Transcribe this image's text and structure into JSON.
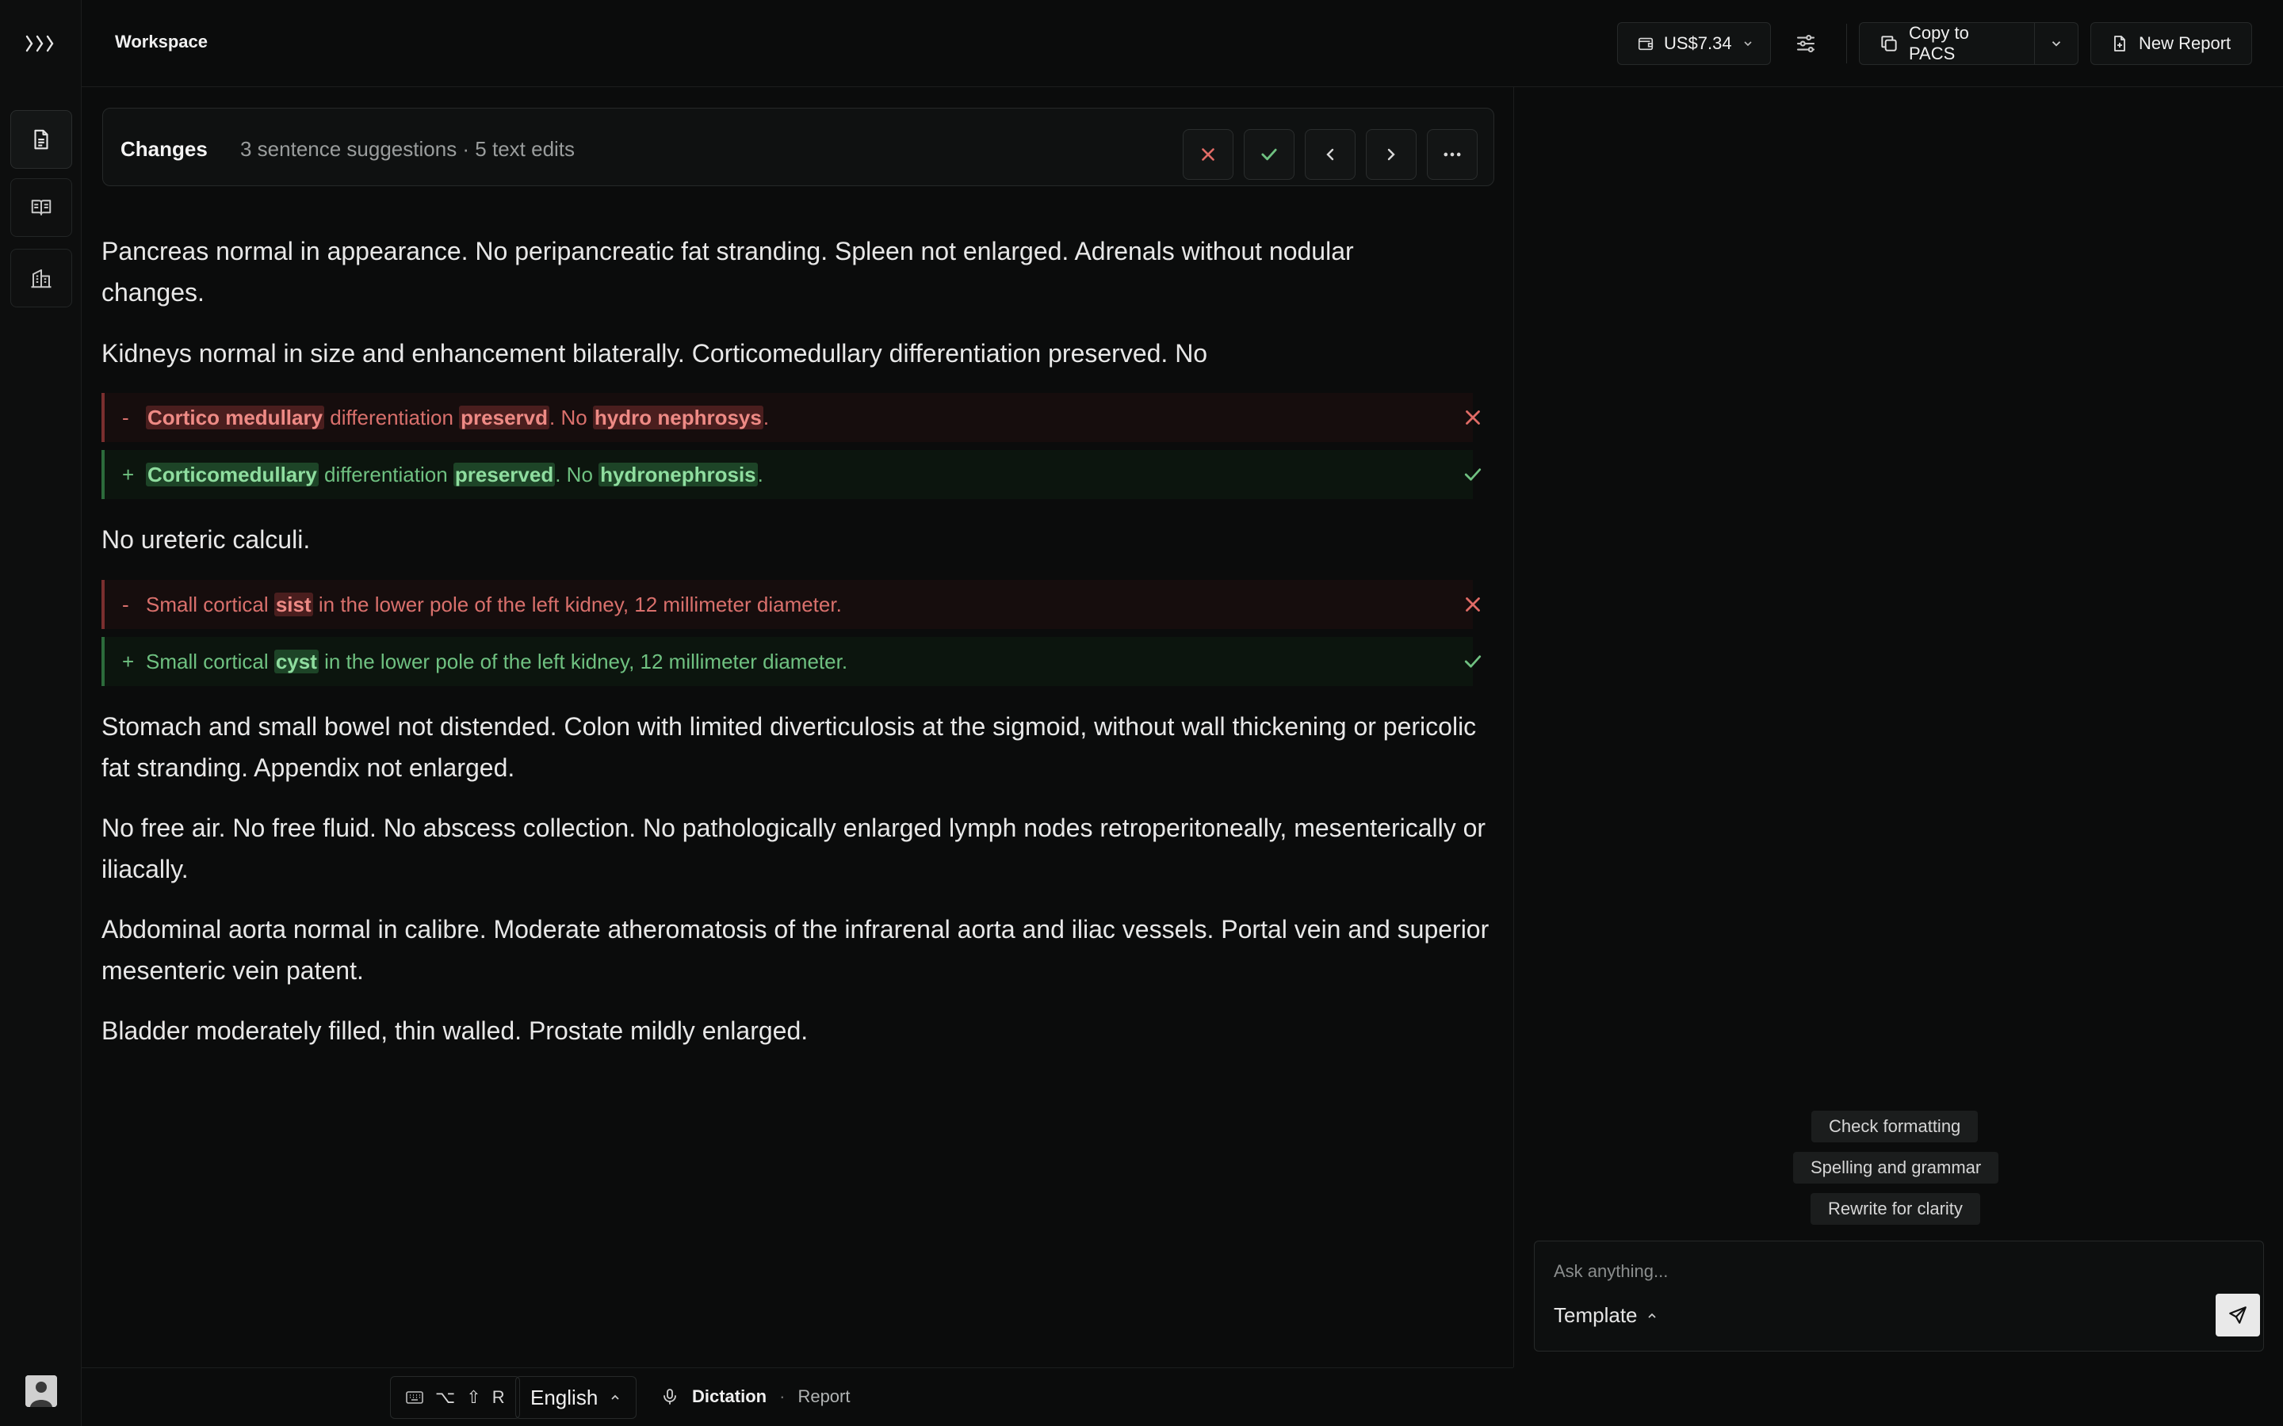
{
  "app": {
    "workspace_label": "Workspace"
  },
  "toolbar": {
    "balance": "US$7.34",
    "copy_label": "Copy to PACS",
    "new_report_label": "New Report"
  },
  "rail": {
    "items": [
      "document-icon",
      "book-icon",
      "building-icon"
    ]
  },
  "changes": {
    "title": "Changes",
    "summary": "3 sentence suggestions · 5 text edits"
  },
  "report": {
    "p1": "Pancreas normal in appearance. No peripancreatic fat stranding. Spleen not enlarged. Adrenals without nodular changes.",
    "p2": "Kidneys normal in size and enhancement bilaterally. Corticomedullary differentiation preserved. No",
    "diff1": {
      "del": {
        "sign": "-",
        "w1": "Cortico medullary",
        "t1": " differentiation ",
        "w2": "preservd",
        "t2": ". No ",
        "w3": "hydro nephrosys",
        "t3": "."
      },
      "add": {
        "sign": "+",
        "w1": "Corticomedullary",
        "t1": " differentiation ",
        "w2": "preserved",
        "t2": ". No ",
        "w3": "hydronephrosis",
        "t3": "."
      }
    },
    "p3": "No ureteric calculi.",
    "diff2": {
      "del": {
        "sign": "-",
        "t1": "Small cortical ",
        "w1": "sist",
        "t2": " in the lower pole of the left kidney, 12 millimeter diameter."
      },
      "add": {
        "sign": "+",
        "t1": "Small cortical ",
        "w1": "cyst",
        "t2": " in the lower pole of the left kidney, 12 millimeter diameter."
      }
    },
    "p4": "Stomach and small bowel not distended. Colon with limited diverticulosis at the sigmoid, without wall thickening or pericolic fat stranding. Appendix not enlarged.",
    "p5": "No free air. No free fluid. No abscess collection. No pathologically enlarged lymph nodes retroperitoneally, mesenterically or iliacally.",
    "p6": "Abdominal aorta normal in calibre. Moderate atheromatosis of the infrarenal aorta and iliac vessels. Portal vein and superior mesenteric vein patent.",
    "p7": "Bladder moderately filled, thin walled. Prostate mildly enlarged."
  },
  "assistant": {
    "suggestions": [
      "Check formatting",
      "Spelling and grammar",
      "Rewrite for clarity"
    ],
    "placeholder": "Ask anything...",
    "template_label": "Template"
  },
  "bottom": {
    "shortcut": {
      "k1": "⌥",
      "k2": "⇧",
      "k3": "R"
    },
    "language": "English",
    "dictation_label": "Dictation",
    "separator": "·",
    "mode": "Report"
  },
  "colors": {
    "accept": "#6fc181",
    "reject": "#e06b66",
    "background": "#0b0c0c"
  }
}
